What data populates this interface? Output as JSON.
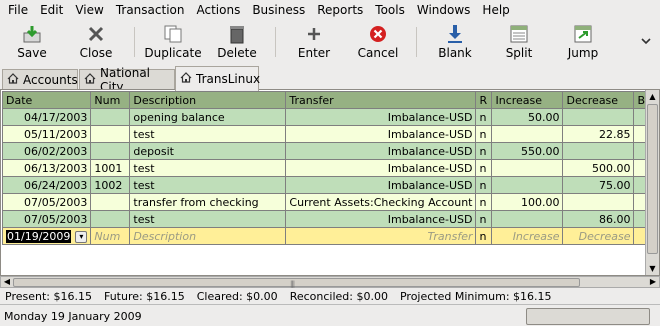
{
  "menu": [
    "File",
    "Edit",
    "View",
    "Transaction",
    "Actions",
    "Business",
    "Reports",
    "Tools",
    "Windows",
    "Help"
  ],
  "toolbar": {
    "save": "Save",
    "close": "Close",
    "duplicate": "Duplicate",
    "delete": "Delete",
    "enter": "Enter",
    "cancel": "Cancel",
    "blank": "Blank",
    "split": "Split",
    "jump": "Jump"
  },
  "tabs": [
    "Accounts",
    "National City",
    "TransLinux"
  ],
  "register": {
    "headers": [
      "Date",
      "Num",
      "Description",
      "Transfer",
      "R",
      "Increase",
      "Decrease",
      "Ba"
    ],
    "rows": [
      {
        "date": "04/17/2003",
        "num": "",
        "desc": "opening balance",
        "transfer": "Imbalance-USD",
        "r": "n",
        "inc": "50.00",
        "dec": ""
      },
      {
        "date": "05/11/2003",
        "num": "",
        "desc": "test",
        "transfer": "Imbalance-USD",
        "r": "n",
        "inc": "",
        "dec": "22.85"
      },
      {
        "date": "06/02/2003",
        "num": "",
        "desc": "deposit",
        "transfer": "Imbalance-USD",
        "r": "n",
        "inc": "550.00",
        "dec": ""
      },
      {
        "date": "06/13/2003",
        "num": "1001",
        "desc": "test",
        "transfer": "Imbalance-USD",
        "r": "n",
        "inc": "",
        "dec": "500.00"
      },
      {
        "date": "06/24/2003",
        "num": "1002",
        "desc": "test",
        "transfer": "Imbalance-USD",
        "r": "n",
        "inc": "",
        "dec": "75.00"
      },
      {
        "date": "07/05/2003",
        "num": "",
        "desc": "transfer from checking",
        "transfer": "Current Assets:Checking Account",
        "r": "n",
        "inc": "100.00",
        "dec": ""
      },
      {
        "date": "07/05/2003",
        "num": "",
        "desc": "test",
        "transfer": "Imbalance-USD",
        "r": "n",
        "inc": "",
        "dec": "86.00"
      }
    ],
    "blank_row": {
      "date": "01/19/2009",
      "num_placeholder": "Num",
      "desc_placeholder": "Description",
      "transfer_placeholder": "Transfer",
      "r": "n",
      "inc_placeholder": "Increase",
      "dec_placeholder": "Decrease"
    }
  },
  "summary": {
    "present": "Present: $16.15",
    "future": "Future: $16.15",
    "cleared": "Cleared: $0.00",
    "reconciled": "Reconciled: $0.00",
    "projected": "Projected Minimum: $16.15"
  },
  "status": "Monday 19 January 2009",
  "colors": {
    "header": "#96b183",
    "row_green": "#bfdeb9",
    "row_yellow": "#f6ffda",
    "row_current": "#ffef98"
  }
}
